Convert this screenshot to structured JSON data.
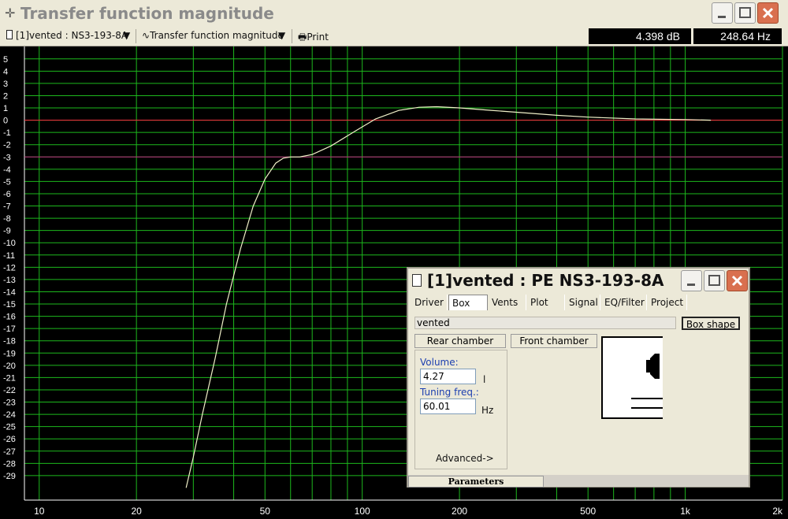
{
  "window": {
    "title": "Transfer function magnitude"
  },
  "toolbar": {
    "project_label": "[1]vented : NS3-193-8A",
    "view_label": "Transfer function magnitude",
    "print_label": "Print",
    "readout_db": "4.398 dB",
    "readout_hz": "248.64 Hz"
  },
  "chart_data": {
    "type": "line",
    "xscale": "log",
    "xlim": [
      9,
      2000
    ],
    "ylim": [
      -31,
      5.5
    ],
    "x_tick_labels": [
      "10",
      "20",
      "50",
      "100",
      "200",
      "500",
      "1k",
      "2k"
    ],
    "x_ticks": [
      10,
      20,
      50,
      100,
      200,
      500,
      1000,
      2000
    ],
    "y_ticks": [
      5,
      4,
      3,
      2,
      1,
      0,
      -1,
      -2,
      -3,
      -4,
      -5,
      -6,
      -7,
      -8,
      -9,
      -10,
      -11,
      -12,
      -13,
      -14,
      -15,
      -16,
      -17,
      -18,
      -19,
      -20,
      -21,
      -22,
      -23,
      -24,
      -25,
      -26,
      -27,
      -28,
      -29
    ],
    "reference_lines": [
      {
        "y": 0,
        "color": "#ff2040"
      },
      {
        "y": -3,
        "color": "#c02080"
      }
    ],
    "grid": true,
    "grid_color": "#1db81d",
    "background": "#000000",
    "series": [
      {
        "color": "#f0f0c8",
        "x": [
          28.5,
          30,
          32,
          35,
          38,
          42,
          46,
          50,
          54,
          57,
          60,
          64,
          70,
          80,
          95,
          110,
          130,
          150,
          170,
          200,
          250,
          300,
          400,
          500,
          700,
          1000,
          1200
        ],
        "y": [
          -30,
          -27.5,
          -24,
          -19.5,
          -15,
          -10.5,
          -7,
          -4.8,
          -3.5,
          -3.1,
          -3.0,
          -3.0,
          -2.8,
          -2.1,
          -0.9,
          0.1,
          0.8,
          1.05,
          1.1,
          1.0,
          0.8,
          0.65,
          0.4,
          0.25,
          0.1,
          0.05,
          0.0
        ]
      }
    ]
  },
  "dialog": {
    "title": "[1]vented : PE NS3-193-8A",
    "tabs": [
      "Driver",
      "Box",
      "Vents",
      "Plot",
      "Signal",
      "EQ/Filter",
      "Project"
    ],
    "active_tab": "Box",
    "box_type": "vented",
    "box_shape_button": "Box shape",
    "rear_chamber_button": "Rear chamber",
    "front_chamber_button": "Front chamber",
    "volume_label": "Volume:",
    "volume_value": "4.27",
    "volume_unit": "l",
    "tuning_label": "Tuning freq.:",
    "tuning_value": "60.01",
    "tuning_unit": "Hz",
    "advanced_link": "Advanced->",
    "status_parameters": "Parameters"
  }
}
